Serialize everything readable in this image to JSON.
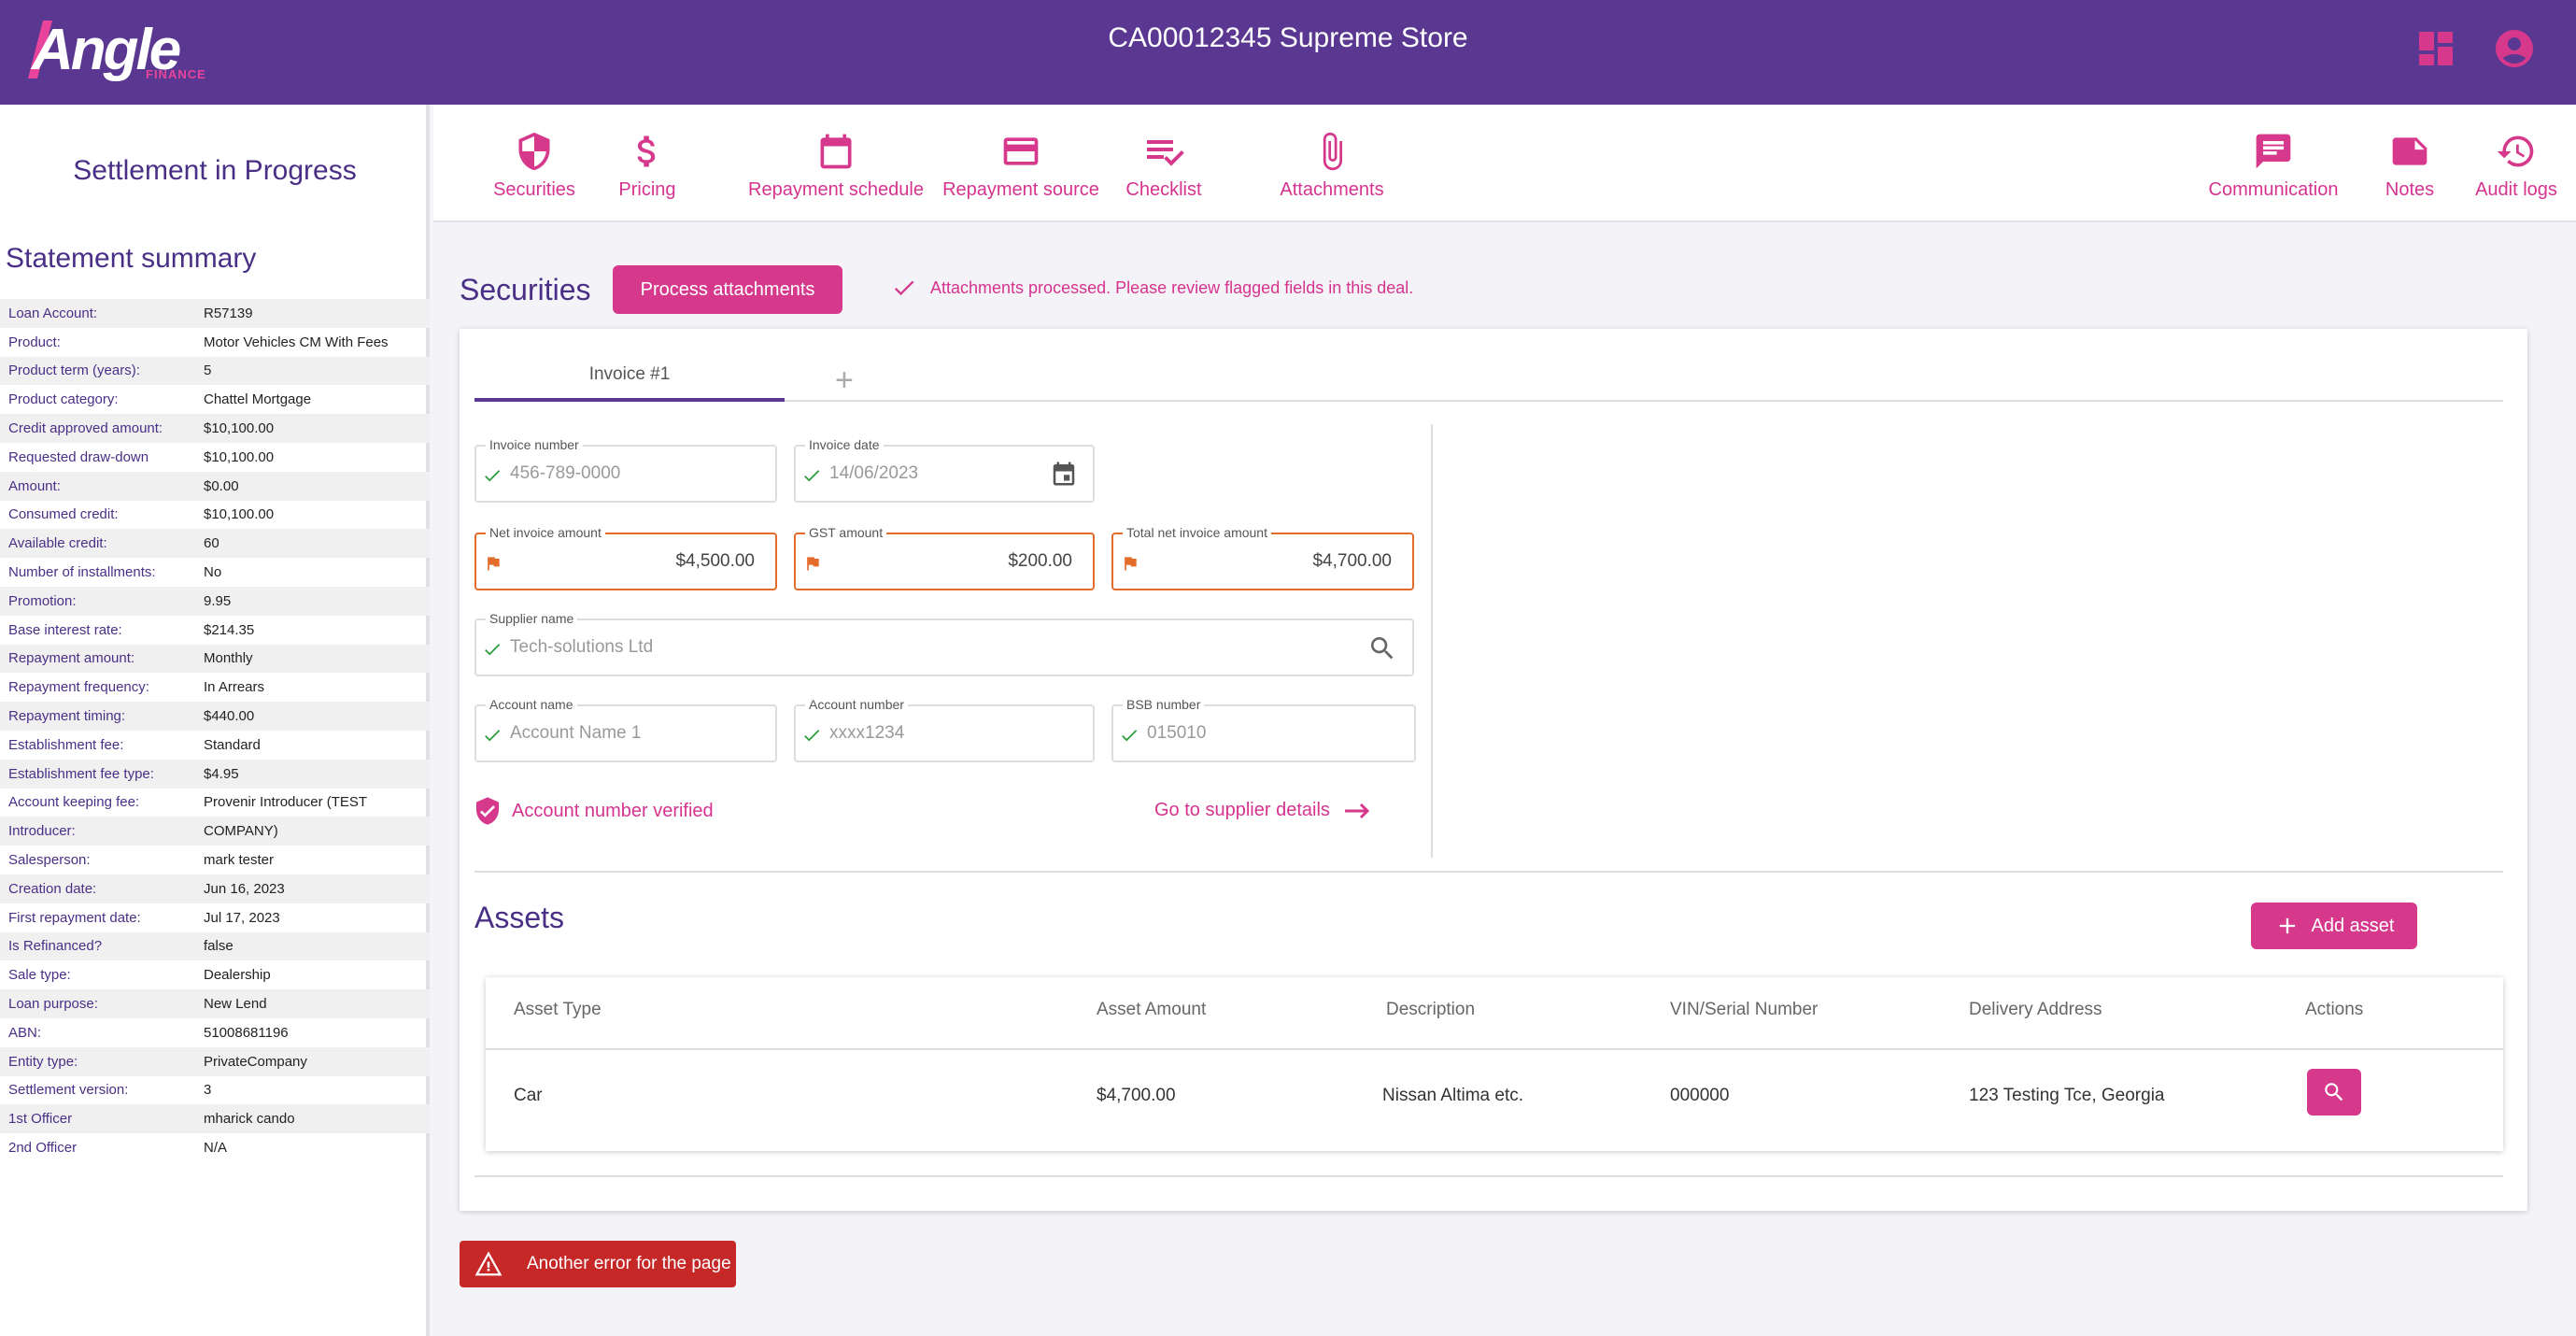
{
  "app": {
    "logo_text": "Angle",
    "logo_sub": "FINANCE",
    "title": "CA00012345 Supreme Store"
  },
  "icons": {
    "dashboard": "dashboard-grid-icon",
    "account": "account-circle-icon"
  },
  "colors": {
    "header": "#5a3891",
    "accent": "#d6388c",
    "flag": "#e46b2a",
    "check": "#2e9e3e",
    "error": "#c62828"
  },
  "sidebar": {
    "title": "Settlement in Progress",
    "subtitle": "Statement summary",
    "rows": [
      {
        "k": "Loan Account:",
        "v": "R57139"
      },
      {
        "k": "Product:",
        "v": "Motor Vehicles CM With Fees"
      },
      {
        "k": "Product term (years):",
        "v": "5"
      },
      {
        "k": "Product category:",
        "v": "Chattel Mortgage"
      },
      {
        "k": "Credit approved amount:",
        "v": "$10,100.00"
      },
      {
        "k": "Requested draw-down",
        "v": "$10,100.00"
      },
      {
        "k": "Amount:",
        "v": "$0.00"
      },
      {
        "k": "Consumed credit:",
        "v": "$10,100.00"
      },
      {
        "k": "Available credit:",
        "v": "60"
      },
      {
        "k": "Number of installments:",
        "v": "No"
      },
      {
        "k": "Promotion:",
        "v": "9.95"
      },
      {
        "k": "Base interest rate:",
        "v": "$214.35"
      },
      {
        "k": "Repayment amount:",
        "v": "Monthly"
      },
      {
        "k": "Repayment frequency:",
        "v": "In Arrears"
      },
      {
        "k": "Repayment timing:",
        "v": "$440.00"
      },
      {
        "k": "Establishment fee:",
        "v": "Standard"
      },
      {
        "k": "Establishment fee type:",
        "v": "$4.95"
      },
      {
        "k": "Account keeping fee:",
        "v": "Provenir Introducer (TEST"
      },
      {
        "k": "Introducer:",
        "v": "COMPANY)"
      },
      {
        "k": "Salesperson:",
        "v": "mark tester"
      },
      {
        "k": "Creation date:",
        "v": "Jun 16, 2023"
      },
      {
        "k": "First repayment date:",
        "v": "Jul 17, 2023"
      },
      {
        "k": "Is Refinanced?",
        "v": "false"
      },
      {
        "k": "Sale type:",
        "v": "Dealership"
      },
      {
        "k": "Loan purpose:",
        "v": "New Lend"
      },
      {
        "k": "ABN:",
        "v": "51008681196"
      },
      {
        "k": "Entity type:",
        "v": "PrivateCompany"
      },
      {
        "k": "Settlement version:",
        "v": "3"
      },
      {
        "k": "1st Officer",
        "v": "mharick cando"
      },
      {
        "k": "2nd Officer",
        "v": "N/A"
      }
    ]
  },
  "nav": [
    {
      "label": "Securities",
      "icon": "shield-icon"
    },
    {
      "label": "Pricing",
      "icon": "dollar-icon"
    },
    {
      "label": "Repayment schedule",
      "icon": "calendar-icon"
    },
    {
      "label": "Repayment source",
      "icon": "credit-card-icon"
    },
    {
      "label": "Checklist",
      "icon": "checklist-icon"
    },
    {
      "label": "Attachments",
      "icon": "paperclip-icon"
    },
    {
      "label": "Communication",
      "icon": "message-icon"
    },
    {
      "label": "Notes",
      "icon": "note-icon"
    },
    {
      "label": "Audit logs",
      "icon": "history-icon"
    }
  ],
  "securities": {
    "title": "Securities",
    "process_button": "Process attachments",
    "process_message": "Attachments processed. Please review flagged fields in this deal.",
    "tab": "Invoice #1",
    "tab_add": "+",
    "fields": {
      "invoice_number": {
        "label": "Invoice number",
        "value": "456-789-0000"
      },
      "invoice_date": {
        "label": "Invoice date",
        "value": "14/06/2023"
      },
      "net_invoice_amount": {
        "label": "Net invoice amount",
        "value": "$4,500.00"
      },
      "gst_amount": {
        "label": "GST amount",
        "value": "$200.00"
      },
      "total_net_invoice_amount": {
        "label": "Total net invoice amount",
        "value": "$4,700.00"
      },
      "supplier_name": {
        "label": "Supplier name",
        "value": "Tech-solutions Ltd"
      },
      "account_name": {
        "label": "Account name",
        "value": "Account Name 1"
      },
      "account_number": {
        "label": "Account number",
        "value": "xxxx1234"
      },
      "bsb_number": {
        "label": "BSB number",
        "value": "015010"
      }
    },
    "verified_text": "Account number verified",
    "supplier_link": "Go to supplier details"
  },
  "assets": {
    "title": "Assets",
    "add_button": "Add asset",
    "columns": [
      "Asset Type",
      "Asset Amount",
      "Description",
      "VIN/Serial Number",
      "Delivery Address",
      "Actions"
    ],
    "rows": [
      {
        "type": "Car",
        "amount": "$4,700.00",
        "description": "Nissan Altima etc.",
        "vin": "000000",
        "address": "123 Testing Tce,  Georgia"
      }
    ]
  },
  "error": {
    "text": "Another error for the page"
  }
}
